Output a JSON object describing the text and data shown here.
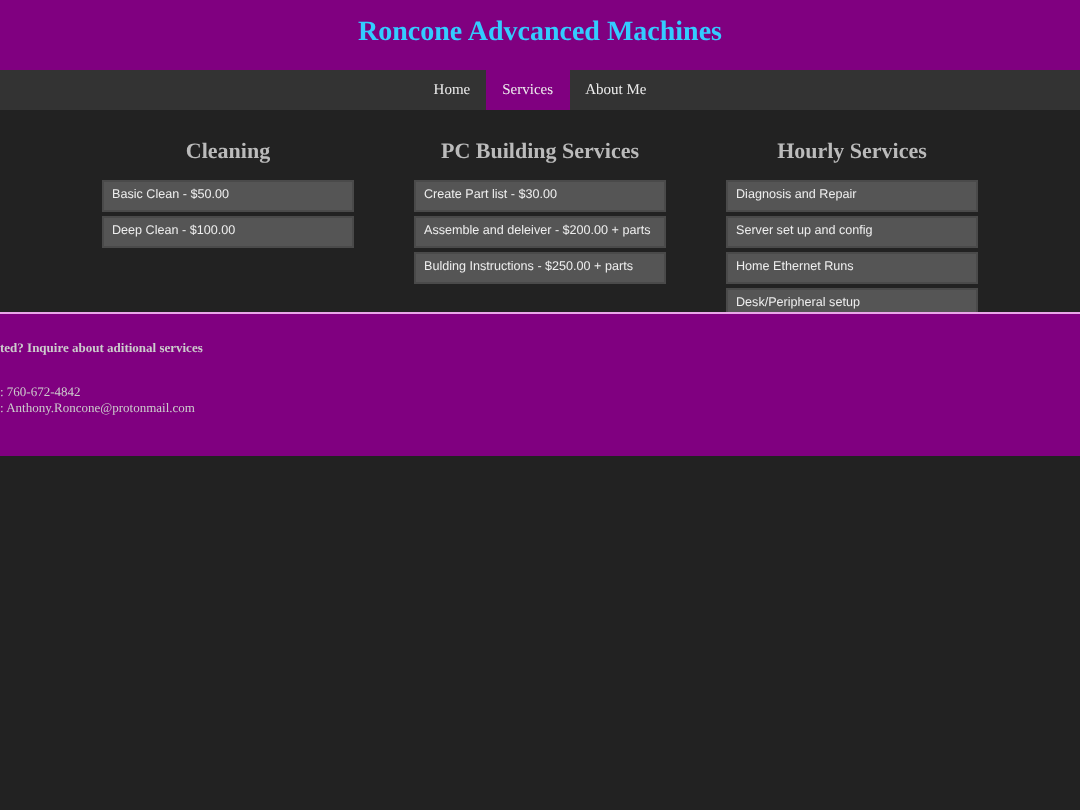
{
  "site_title": "Roncone Advcanced Machines",
  "nav": [
    {
      "label": "Home",
      "selected": false
    },
    {
      "label": "Services",
      "selected": true
    },
    {
      "label": "About Me",
      "selected": false
    }
  ],
  "columns": [
    {
      "heading": "Cleaning",
      "items": [
        "Basic Clean - $50.00",
        "Deep Clean - $100.00"
      ]
    },
    {
      "heading": "PC Building Services",
      "items": [
        "Create Part list - $30.00",
        "Assemble and deleiver - $200.00 + parts",
        "Bulding Instructions - $250.00 + parts"
      ]
    },
    {
      "heading": "Hourly Services",
      "items": [
        "Diagnosis and Repair",
        "Server set up and config",
        "Home Ethernet Runs",
        "Desk/Peripheral setup"
      ]
    }
  ],
  "footer": {
    "heading": "ted? Inquire about aditional services",
    "phone": ": 760-672-4842",
    "email": ": Anthony.Roncone@protonmail.com"
  }
}
